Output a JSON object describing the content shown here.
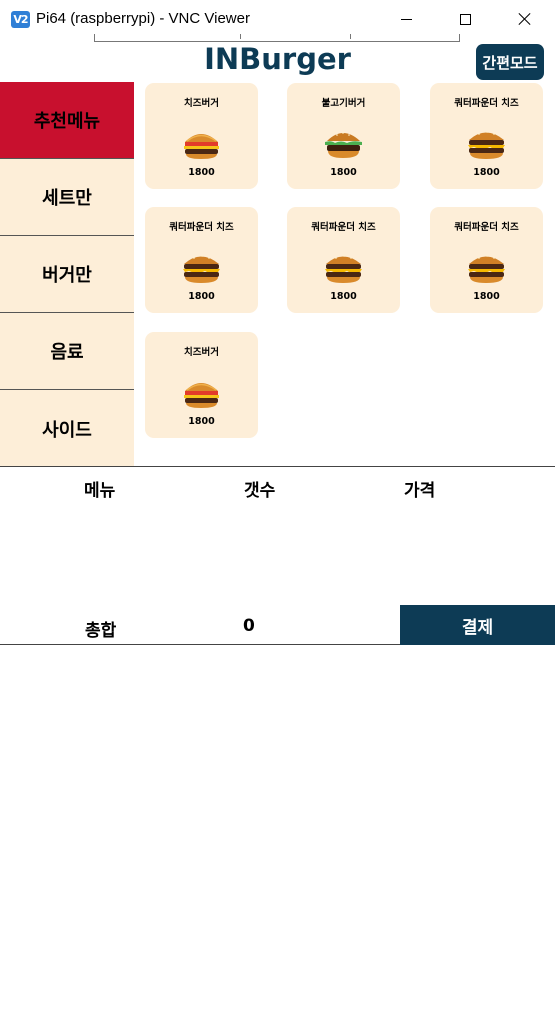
{
  "window": {
    "title": "Pi64 (raspberrypi) - VNC Viewer",
    "app_icon_text": "V2"
  },
  "header": {
    "brand": "INBurger",
    "simple_mode_label": "간편모드"
  },
  "sidebar": {
    "items": [
      {
        "label": "추천메뉴",
        "active": true
      },
      {
        "label": "세트만",
        "active": false
      },
      {
        "label": "버거만",
        "active": false
      },
      {
        "label": "음료",
        "active": false
      },
      {
        "label": "사이드",
        "active": false
      }
    ]
  },
  "menu": {
    "items": [
      {
        "name": "치즈버거",
        "price": "1800",
        "icon": "cheeseburger-icon"
      },
      {
        "name": "불고기버거",
        "price": "1800",
        "icon": "bulgogi-burger-icon"
      },
      {
        "name": "쿼터파운더 치즈",
        "price": "1800",
        "icon": "quarter-pounder-icon"
      },
      {
        "name": "쿼터파운더 치즈",
        "price": "1800",
        "icon": "quarter-pounder-icon"
      },
      {
        "name": "쿼터파운더 치즈",
        "price": "1800",
        "icon": "quarter-pounder-icon"
      },
      {
        "name": "쿼터파운더 치즈",
        "price": "1800",
        "icon": "quarter-pounder-icon"
      },
      {
        "name": "치즈버거",
        "price": "1800",
        "icon": "cheeseburger-icon"
      }
    ]
  },
  "order": {
    "col_menu": "메뉴",
    "col_count": "갯수",
    "col_price": "가격",
    "total_label": "총합",
    "total_count": "0",
    "pay_label": "결제"
  },
  "colors": {
    "brand": "#0d3b55",
    "active_category": "#c8102e",
    "card_bg": "#fdeed8"
  }
}
